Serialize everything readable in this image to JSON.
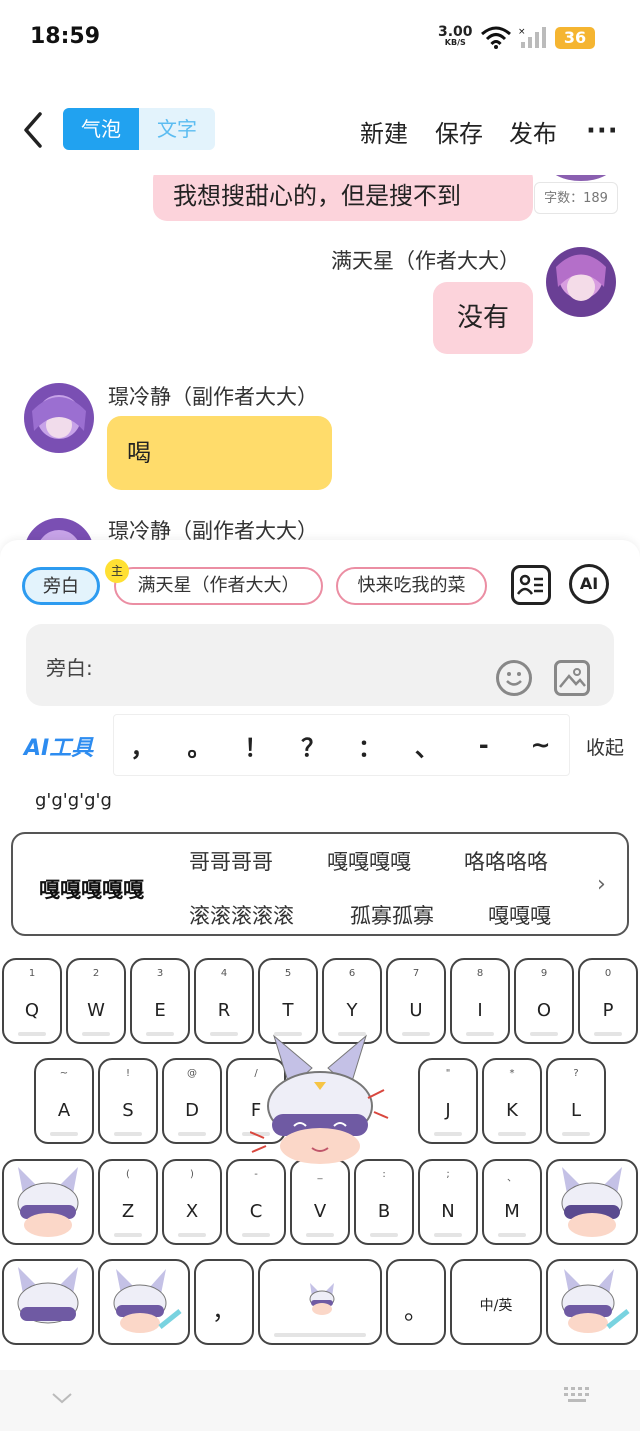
{
  "status": {
    "time": "18:59",
    "speed_value": "3.00",
    "speed_unit": "KB/S",
    "battery": "36"
  },
  "header": {
    "tab_bubble": "气泡",
    "tab_text": "文字",
    "new_label": "新建",
    "save_label": "保存",
    "publish_label": "发布",
    "more_label": "···"
  },
  "chat": {
    "word_count": "字数：189",
    "messages": [
      {
        "speaker": "",
        "text": "我想搜甜心的，但是搜不到"
      },
      {
        "speaker": "满天星（作者大大）",
        "text": "没有"
      },
      {
        "speaker": "璟冷静（副作者大大）",
        "text": "喝"
      },
      {
        "speaker": "璟冷静（副作者大大）",
        "text": ""
      }
    ]
  },
  "editor": {
    "roles": [
      "旁白",
      "满天星（作者大大）",
      "快来吃我的菜"
    ],
    "host_badge": "主",
    "ai_circle": "AI",
    "input_label": "旁白:",
    "ai_tools": "AI工具",
    "punctuation": [
      "，",
      "。",
      "！",
      "？",
      "：",
      "、",
      "-",
      "~"
    ],
    "collapse": "收起"
  },
  "keyboard": {
    "composing": "g'g'g'g'g",
    "first_candidate": "嘎嘎嘎嘎嘎",
    "candidates": [
      "哥哥哥哥",
      "嘎嘎嘎嘎",
      "咯咯咯咯",
      "滚滚滚滚滚",
      "孤寡孤寡",
      "嘎嘎嘎"
    ],
    "row1": [
      {
        "l": "Q",
        "s": "1"
      },
      {
        "l": "W",
        "s": "2"
      },
      {
        "l": "E",
        "s": "3"
      },
      {
        "l": "R",
        "s": "4"
      },
      {
        "l": "T",
        "s": "5"
      },
      {
        "l": "Y",
        "s": "6"
      },
      {
        "l": "U",
        "s": "7"
      },
      {
        "l": "I",
        "s": "8"
      },
      {
        "l": "O",
        "s": "9"
      },
      {
        "l": "P",
        "s": "0"
      }
    ],
    "row2": [
      {
        "l": "A",
        "s": "~"
      },
      {
        "l": "S",
        "s": "!"
      },
      {
        "l": "D",
        "s": "@"
      },
      {
        "l": "F",
        "s": "/"
      },
      {
        "l": "J",
        "s": "\""
      },
      {
        "l": "K",
        "s": "*"
      },
      {
        "l": "L",
        "s": "?"
      }
    ],
    "row3": [
      {
        "l": "Z",
        "s": "("
      },
      {
        "l": "X",
        "s": ")"
      },
      {
        "l": "C",
        "s": "-"
      },
      {
        "l": "V",
        "s": "_"
      },
      {
        "l": "B",
        "s": ":"
      },
      {
        "l": "N",
        "s": ";"
      },
      {
        "l": "M",
        "s": "、"
      }
    ],
    "comma": "，",
    "period": "。",
    "zh_en": "中/英"
  },
  "colors": {
    "accent_blue": "#21a2f0",
    "bubble_pink": "#fcd3db",
    "bubble_yellow": "#ffdc6b",
    "chip_pink_border": "#eb8ea3",
    "battery": "#f5b531"
  }
}
